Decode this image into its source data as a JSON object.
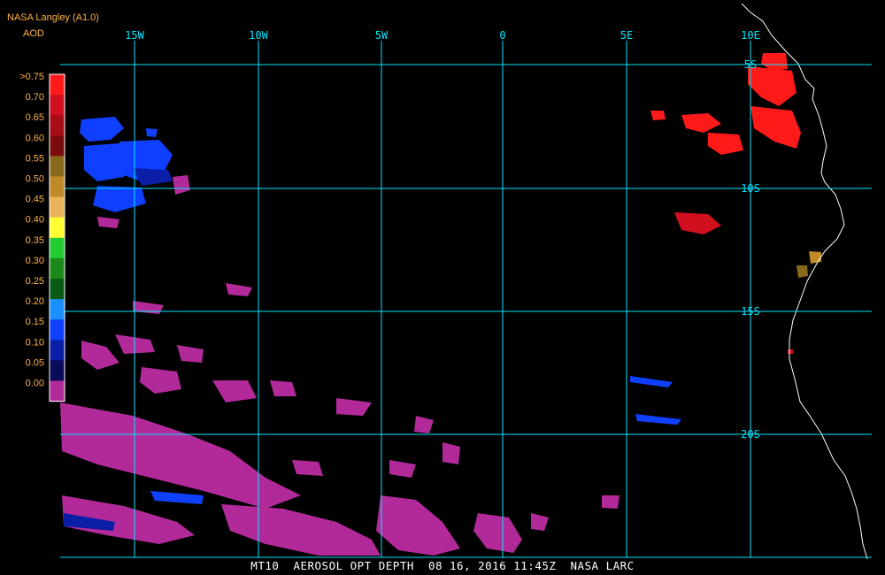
{
  "header": {
    "provider": "NASA Langley (A1.0)",
    "product": "AOD"
  },
  "footer": {
    "text": "MT10  AEROSOL OPT DEPTH  08 16, 2016 11:45Z  NASA LARC"
  },
  "grid": {
    "longitude_labels": [
      "15W",
      "10W",
      "5W",
      "0",
      "5E",
      "10E"
    ],
    "latitude_labels": [
      "5S",
      "10S",
      "15S",
      "20S"
    ],
    "line_color": "#00e5ff"
  },
  "legend": {
    "labels": [
      ">0.75",
      "0.70",
      "0.65",
      "0.60",
      "0.55",
      "0.50",
      "0.45",
      "0.40",
      "0.35",
      "0.30",
      "0.25",
      "0.20",
      "0.15",
      "0.10",
      "0.05",
      "0.00"
    ],
    "colors": [
      "#ff1a1a",
      "#d10f1e",
      "#a80c17",
      "#7a0c0c",
      "#8a6a1a",
      "#c08a28",
      "#eab55a",
      "#ffff33",
      "#22cc33",
      "#1a8a1a",
      "#0a5a14",
      "#1a90ff",
      "#1040ff",
      "#0a1ea8",
      "#0a0a5a",
      "#b22a9a"
    ]
  }
}
